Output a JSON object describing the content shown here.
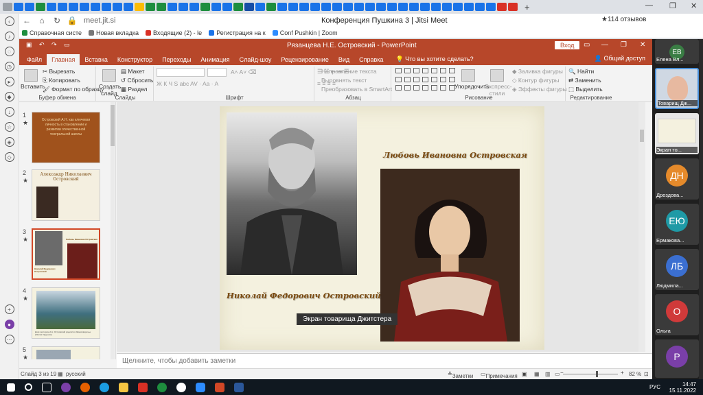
{
  "browser": {
    "url": "meet.jit.si",
    "page_title": "Конференция Пушкина 3 | Jitsi Meet",
    "reviews": "★114 отзывов",
    "bookmarks": [
      "Справочная систе",
      "Новая вкладка",
      "Входящие (2) - le",
      "Регистрация на к",
      "Conf Pushkin | Zoom"
    ]
  },
  "ppt": {
    "doc_title": "Рязанцева Н.Е. Островский  -  PowerPoint",
    "login": "Вход",
    "tabs": [
      "Файл",
      "Главная",
      "Вставка",
      "Конструктор",
      "Переходы",
      "Анимация",
      "Слайд-шоу",
      "Рецензирование",
      "Вид",
      "Справка"
    ],
    "search_hint": "Что вы хотите сделать?",
    "share": "Общий доступ",
    "ribbon": {
      "paste": "Вставить",
      "cut": "Вырезать",
      "copy": "Копировать",
      "format_painter": "Формат по образцу",
      "clipboard_group": "Буфер обмена",
      "new_slide": "Создать слайд",
      "layout": "Макет",
      "reset": "Сбросить",
      "section": "Раздел",
      "slides_group": "Слайды",
      "font_group": "Шрифт",
      "text_direction": "Направление текста",
      "align_text": "Выровнять текст",
      "smartart": "Преобразовать в SmartArt",
      "paragraph_group": "Абзац",
      "arrange": "Упорядочить",
      "quick_styles": "Экспресс-стили",
      "shape_fill": "Заливка фигуры",
      "shape_outline": "Контур фигуры",
      "shape_effects": "Эффекты фигуры",
      "drawing_group": "Рисование",
      "find": "Найти",
      "replace": "Заменить",
      "select": "Выделить",
      "editing_group": "Редактирование"
    },
    "thumbnails": [
      {
        "num": "1",
        "title": "Островский А.Н. как ключевая личность в становлении и развитии отечественной театральной школы"
      },
      {
        "num": "2",
        "title": "Александр Николаевич Островский"
      },
      {
        "num": "3",
        "title": ""
      },
      {
        "num": "4",
        "title": ""
      },
      {
        "num": "5",
        "title": ""
      }
    ],
    "thumb3_caption_left": "Николай Федорович Островский",
    "thumb3_caption_right": "Любовь Ивановна Островская",
    "thumb4_caption": "Дом в котором А.Н. Островский родился в Замоскворечье (Малая Ордынка)",
    "slide": {
      "caption_right": "Любовь Ивановна Островская",
      "caption_left": "Николай Федорович Островский"
    },
    "notes_placeholder": "Щелкните, чтобы добавить заметки",
    "status": {
      "slide_of": "Слайд 3 из 19",
      "language": "русский",
      "notes": "Заметки",
      "comments": "Примечания",
      "zoom": "82 %"
    }
  },
  "screen_label": "Экран товарища Джитстера",
  "participants": [
    {
      "initials": "ЕВ",
      "name": "Елена Вл...",
      "color": "#3a7d44"
    },
    {
      "initials": "",
      "name": "Товарищ Дж...",
      "color": "#cfd8e3"
    },
    {
      "initials": "",
      "name": "Экран то...",
      "color": "#e6e6e6"
    },
    {
      "initials": "ДН",
      "name": "Дроздова...",
      "color": "#e58a2b"
    },
    {
      "initials": "ЕЮ",
      "name": "Ермакова...",
      "color": "#1f9aa6"
    },
    {
      "initials": "ЛБ",
      "name": "Людмила...",
      "color": "#3b6fd1"
    },
    {
      "initials": "О",
      "name": "Ольга",
      "color": "#d03a3a"
    },
    {
      "initials": "Р",
      "name": "",
      "color": "#7a3fa8"
    }
  ],
  "taskbar": {
    "lang": "РУС",
    "time": "14:47",
    "date": "15.11.2022"
  }
}
